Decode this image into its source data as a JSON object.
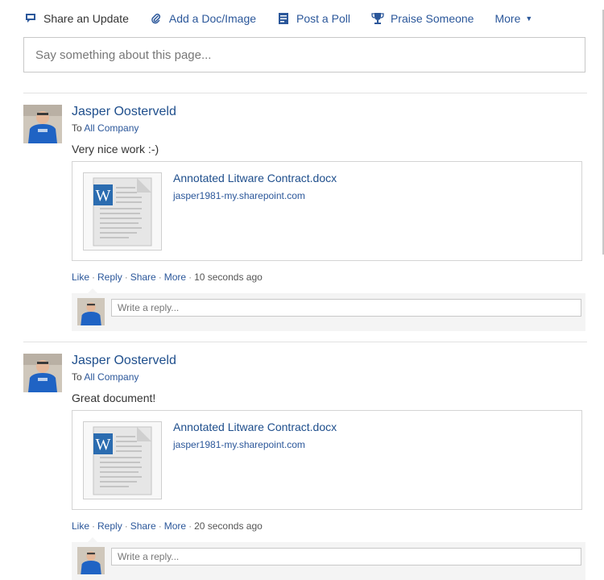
{
  "publisher": {
    "tabs": [
      {
        "label": "Share an Update",
        "icon": "speech-bubble-icon"
      },
      {
        "label": "Add a Doc/Image",
        "icon": "paperclip-icon"
      },
      {
        "label": "Post a Poll",
        "icon": "poll-icon"
      },
      {
        "label": "Praise Someone",
        "icon": "trophy-icon"
      },
      {
        "label": "More",
        "icon": "caret-down-icon"
      }
    ],
    "placeholder": "Say something about this page..."
  },
  "posts": [
    {
      "author": "Jasper Oosterveld",
      "to_prefix": "To",
      "to_target": "All Company",
      "body": "Very nice work :-)",
      "attachment": {
        "title": "Annotated Litware Contract.docx",
        "url": "jasper1981-my.sharepoint.com",
        "icon": "word-document-icon"
      },
      "actions": {
        "like": "Like",
        "reply": "Reply",
        "share": "Share",
        "more": "More",
        "time": "10 seconds ago"
      },
      "reply_placeholder": "Write a reply..."
    },
    {
      "author": "Jasper Oosterveld",
      "to_prefix": "To",
      "to_target": "All Company",
      "body": "Great document!",
      "attachment": {
        "title": "Annotated Litware Contract.docx",
        "url": "jasper1981-my.sharepoint.com",
        "icon": "word-document-icon"
      },
      "actions": {
        "like": "Like",
        "reply": "Reply",
        "share": "Share",
        "more": "More",
        "time": "20 seconds ago"
      },
      "reply_placeholder": "Write a reply..."
    }
  ],
  "colors": {
    "link": "#2b579a",
    "author": "#1e4e8c",
    "reply_bg": "#f4f4f4"
  }
}
